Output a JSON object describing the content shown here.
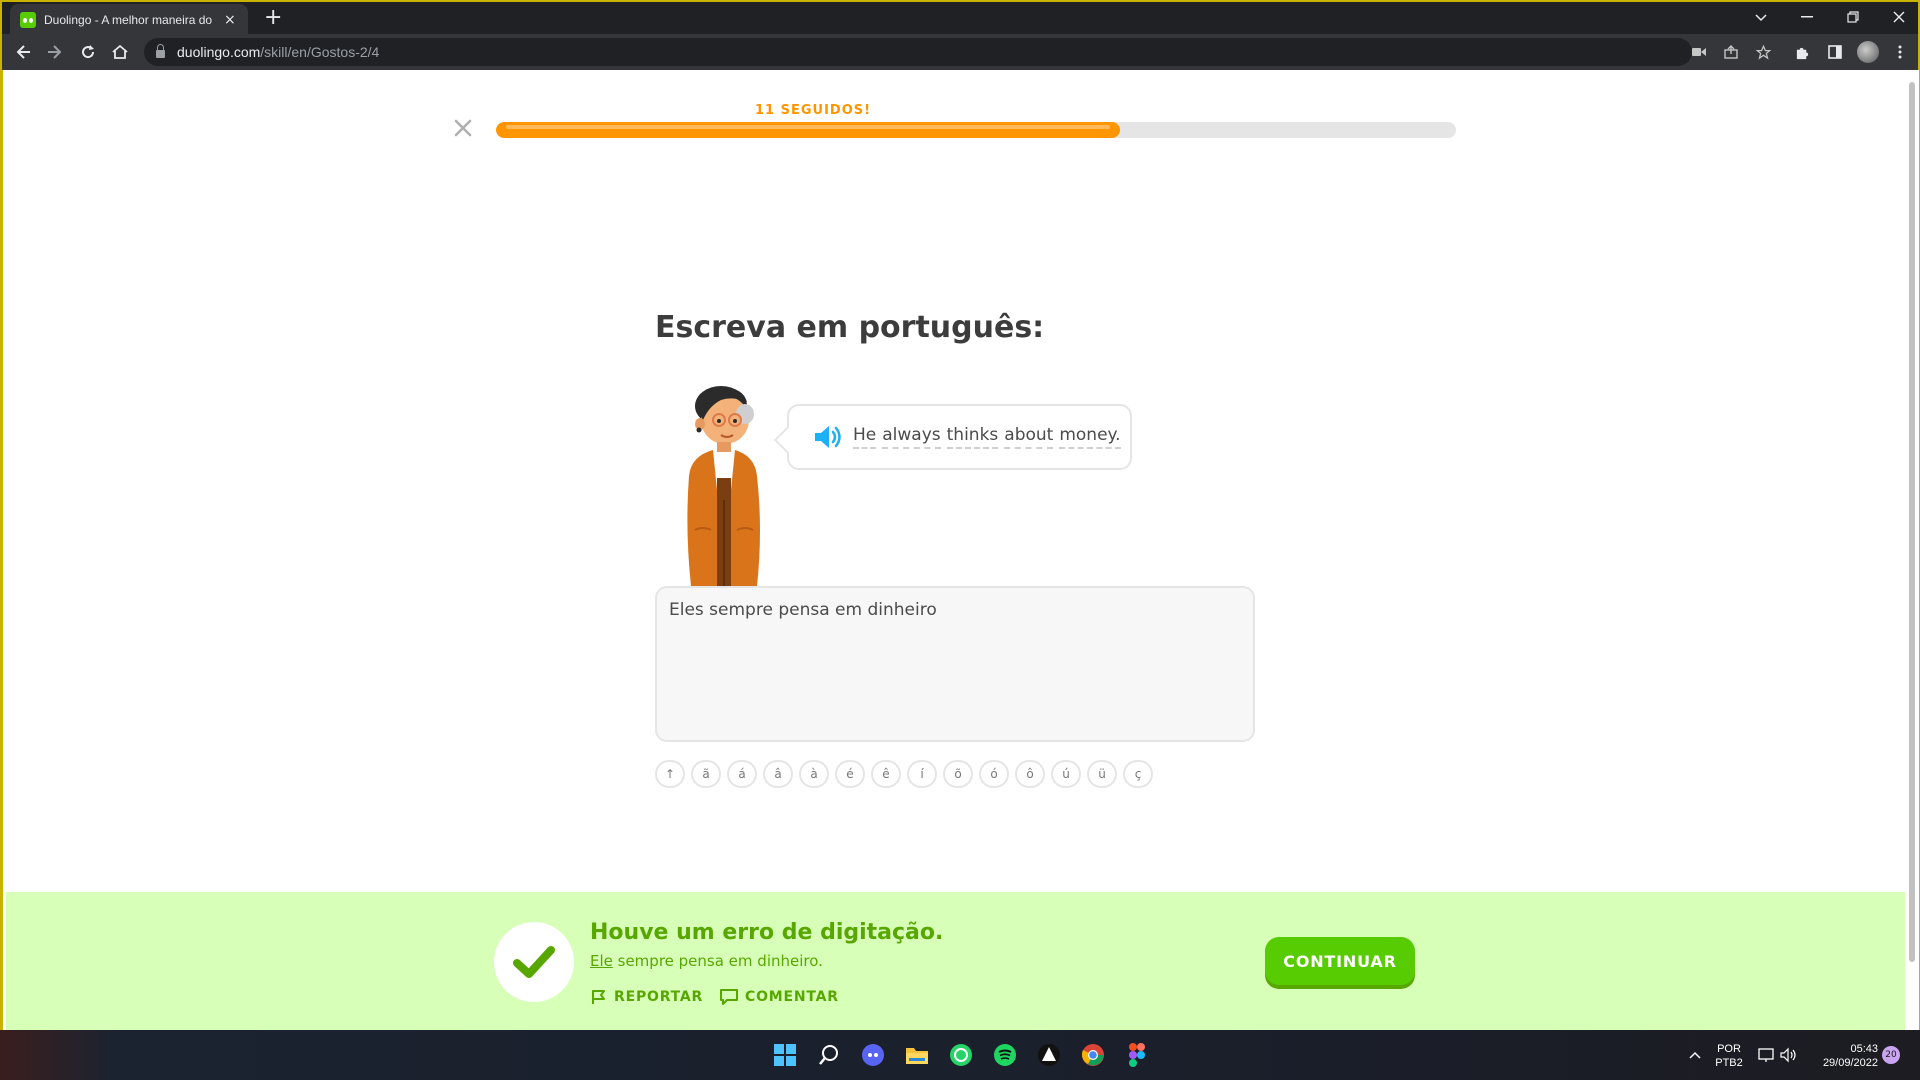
{
  "browser": {
    "tab_title": "Duolingo - A melhor maneira do",
    "tab_close": "×",
    "new_tab": "+",
    "url_host": "duolingo.com",
    "url_path": "/skill/en/Gostos-2/4"
  },
  "lesson": {
    "streak_label": "11 SEGUIDOS!",
    "progress": 0.65,
    "heading": "Escreva em português:",
    "prompt_words": [
      "He",
      "always",
      "thinks",
      "about",
      "money."
    ],
    "answer_value": "Eles sempre pensa em dinheiro",
    "accent_keys": [
      "↑",
      "ã",
      "á",
      "â",
      "à",
      "é",
      "ê",
      "í",
      "õ",
      "ó",
      "ô",
      "ú",
      "ü",
      "ç"
    ]
  },
  "feedback": {
    "title": "Houve um erro de digitação.",
    "answer_highlight": "Ele",
    "answer_rest": " sempre pensa em dinheiro.",
    "report_label": "REPORTAR",
    "comment_label": "COMENTAR",
    "continue_label": "CONTINUAR"
  },
  "taskbar": {
    "lang_top": "POR",
    "lang_bottom": "PTB2",
    "time": "05:43",
    "date": "29/09/2022",
    "notifications": "20"
  },
  "colors": {
    "brand_green": "#58cc02",
    "dark_green": "#58a700",
    "feedback_bg": "#d7ffb8",
    "progress_orange": "#ff9600",
    "speaker_blue": "#1cb0f6"
  }
}
